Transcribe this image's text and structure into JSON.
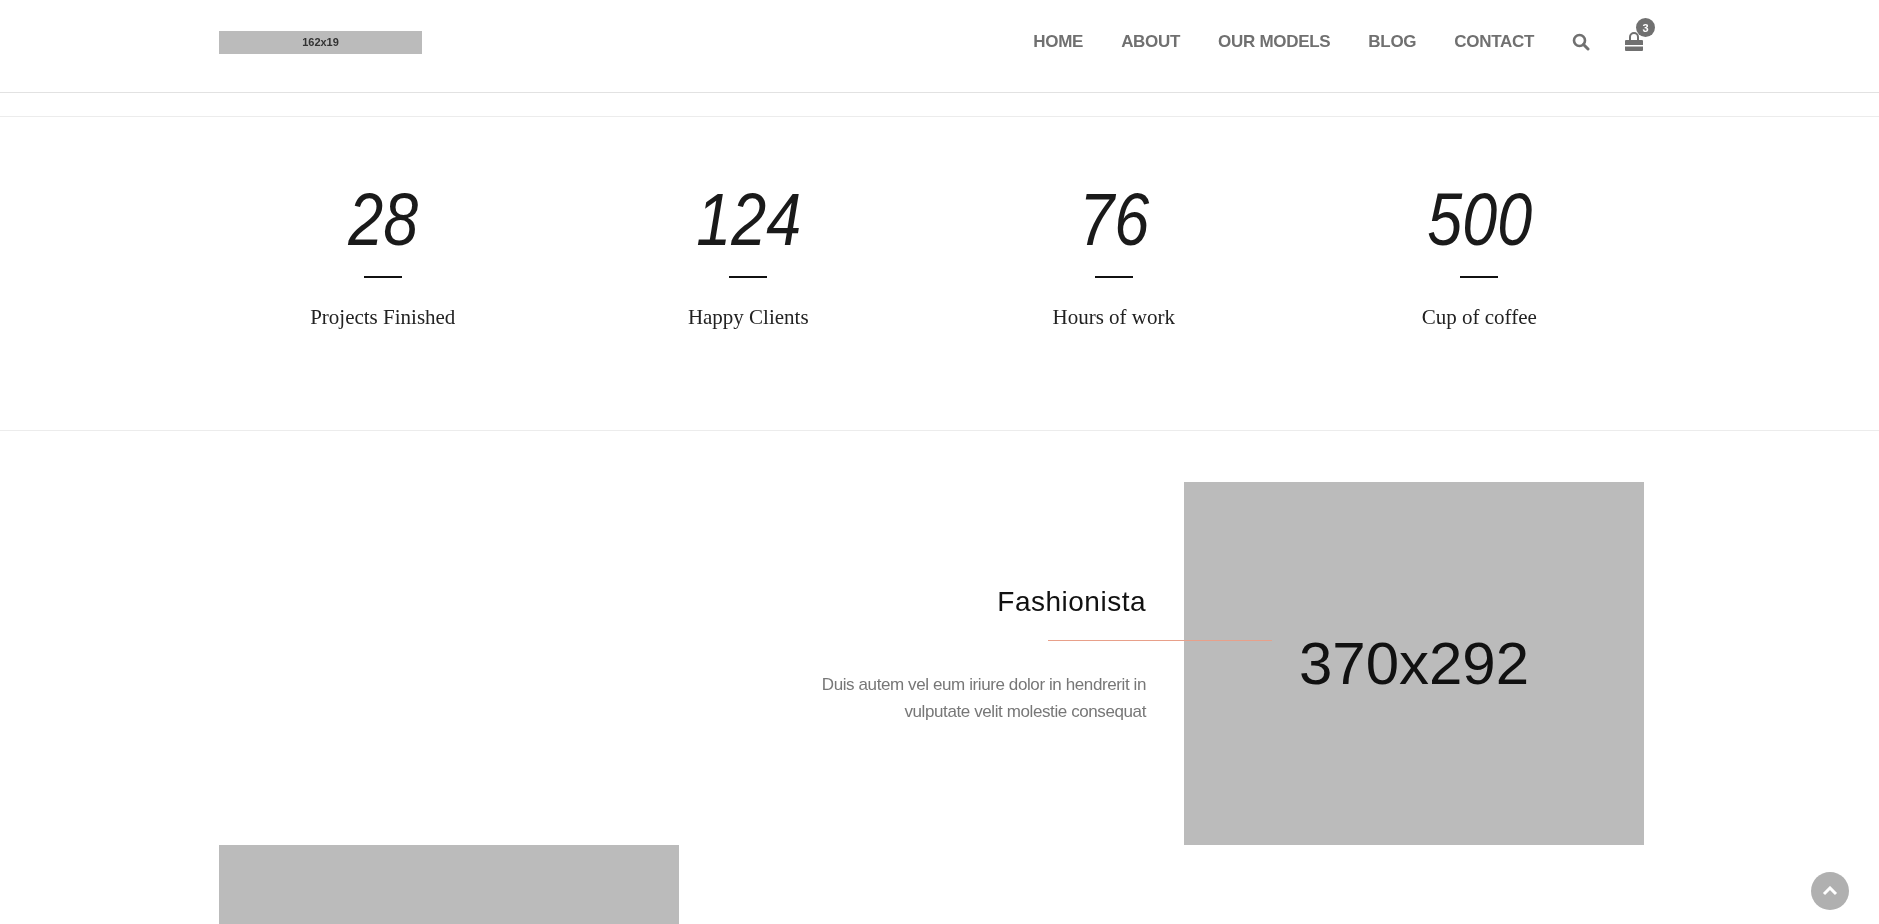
{
  "header": {
    "logo": "162x19",
    "nav": [
      {
        "label": "HOME"
      },
      {
        "label": "ABOUT"
      },
      {
        "label": "OUR MODELS"
      },
      {
        "label": "BLOG"
      },
      {
        "label": "CONTACT"
      }
    ],
    "cart_count": "3"
  },
  "stats": [
    {
      "number": "28",
      "label": "Projects Finished"
    },
    {
      "number": "124",
      "label": "Happy Clients"
    },
    {
      "number": "76",
      "label": "Hours of work"
    },
    {
      "number": "500",
      "label": "Cup of coffee"
    }
  ],
  "feature": {
    "title": "Fashionista",
    "text": "Duis autem vel eum iriure dolor in hendrerit in vulputate velit molestie consequat",
    "image": "370x292"
  }
}
